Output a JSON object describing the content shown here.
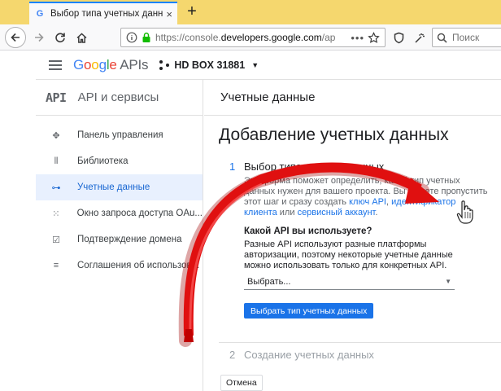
{
  "browser": {
    "tab_title": "Выбор типа учетных данны",
    "tab_favicon": "G",
    "tab_close": "×",
    "new_tab": "+",
    "url_prefix": "https://console.",
    "url_host": "developers.google.com",
    "url_suffix": "/ap",
    "url_more": "•••",
    "search_placeholder": "Поиск"
  },
  "header": {
    "logo_google": [
      "G",
      "o",
      "o",
      "g",
      "l",
      "e"
    ],
    "logo_apis": " APIs",
    "project_name": "HD BOX 31881",
    "project_caret": "▼"
  },
  "sidebar": {
    "api_mark": "API",
    "title": "API и сервисы",
    "items": [
      {
        "label": "Панель управления",
        "icon": "dashboard-icon",
        "glyph": "✥",
        "active": false
      },
      {
        "label": "Библиотека",
        "icon": "library-icon",
        "glyph": "⦀",
        "active": false
      },
      {
        "label": "Учетные данные",
        "icon": "key-icon",
        "glyph": "⊶",
        "active": true
      },
      {
        "label": "Окно запроса доступа OAu...",
        "icon": "consent-icon",
        "glyph": "⁙",
        "active": false
      },
      {
        "label": "Подтверждение домена",
        "icon": "domain-check-icon",
        "glyph": "☑",
        "active": false
      },
      {
        "label": "Соглашения об использов...",
        "icon": "agreements-icon",
        "glyph": "≡",
        "active": false
      }
    ]
  },
  "main": {
    "header": "Учетные данные",
    "page_title": "Добавление учетных данных",
    "step1": {
      "number": "1",
      "title": "Выбор типа учетных данных",
      "desc_part1": "Эта форма поможет определить, какой тип учетных данных нужен для вашего проекта.",
      "desc_part2": "Вы можете пропустить этот шаг и сразу создать ",
      "link_api_key": "ключ API",
      "desc_comma": ", ",
      "link_client_id": "идентификатор клиента",
      "desc_or": " или ",
      "link_service_account": "сервисный аккаунт",
      "desc_end": ".",
      "question": "Какой API вы используете?",
      "question_desc": "Разные API используют разные платформы авторизации, поэтому некоторые учетные данные можно использовать только для конкретных API.",
      "select_value": "Выбрать...",
      "select_arrow": "▼",
      "button_label": "Выбрать тип учетных данных"
    },
    "step2": {
      "number": "2",
      "title": "Создание учетных данных"
    },
    "cancel_label": "Отмена"
  },
  "colors": {
    "accent": "#1a73e8",
    "active_bg": "#e8f0fe",
    "annotation_arrow": "#e01010",
    "frame": "#f1d84a"
  }
}
